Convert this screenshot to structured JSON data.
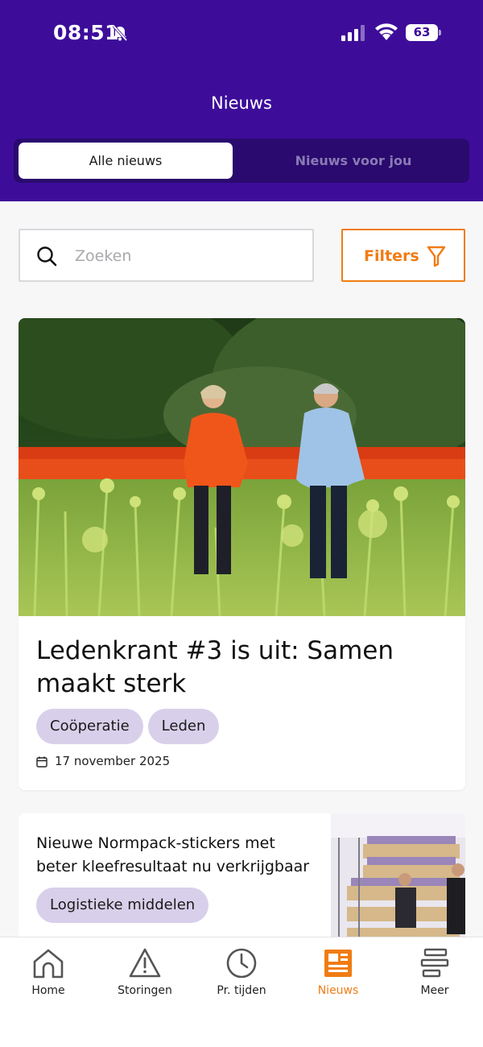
{
  "status_bar": {
    "time": "08:51",
    "battery": "63"
  },
  "header": {
    "title": "Nieuws",
    "tabs": [
      {
        "label": "Alle nieuws",
        "active": true
      },
      {
        "label": "Nieuws voor jou",
        "active": false
      }
    ]
  },
  "search": {
    "placeholder": "Zoeken"
  },
  "filters": {
    "label": "Filters"
  },
  "articles": [
    {
      "title": "Ledenkrant #3 is uit: Samen maakt sterk",
      "tags": [
        "Coöperatie",
        "Leden"
      ],
      "date": "17 november 2025"
    },
    {
      "title": "Nieuwe Normpack-stickers met beter kleefresultaat nu verkrijgbaar",
      "tags": [
        "Logistieke middelen"
      ]
    }
  ],
  "bottom_nav": [
    {
      "label": "Home",
      "icon": "home-icon"
    },
    {
      "label": "Storingen",
      "icon": "warning-icon"
    },
    {
      "label": "Pr. tijden",
      "icon": "clock-icon"
    },
    {
      "label": "Nieuws",
      "icon": "newspaper-icon",
      "active": true
    },
    {
      "label": "Meer",
      "icon": "more-icon"
    }
  ],
  "colors": {
    "brand": "#3d0d9a",
    "accent": "#f07c13",
    "tag": "#d8d0ea"
  }
}
